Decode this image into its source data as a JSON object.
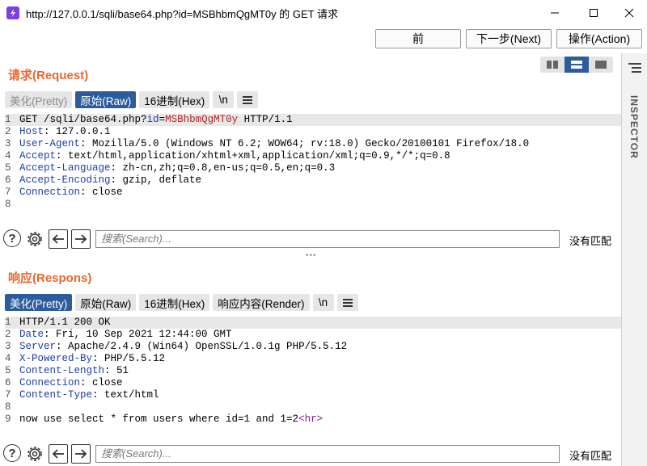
{
  "window": {
    "title": "http://127.0.0.1/sqli/base64.php?id=MSBhbmQgMT0y 的 GET 请求",
    "controls": {
      "minimize": "—",
      "maximize": "☐",
      "close": "✕"
    }
  },
  "nav": {
    "prev_label": "前",
    "next_label": "下一步(Next)",
    "action_label": "操作(Action)"
  },
  "inspector": {
    "label": "INSPECTOR"
  },
  "request": {
    "title": "请求(Request)",
    "tabs": [
      "美化(Pretty)",
      "原始(Raw)",
      "16进制(Hex)",
      "\\n"
    ],
    "lines": [
      {
        "n": "1",
        "method": "GET ",
        "path": "/sqli/base64.php?",
        "param": "id",
        "eq": "=",
        "val": "MSBhbmQgMT0y",
        "rest": " HTTP/1.1"
      },
      {
        "n": "2",
        "key": "Host",
        "value": ": 127.0.0.1"
      },
      {
        "n": "3",
        "key": "User-Agent",
        "value": ": Mozilla/5.0 (Windows NT 6.2; WOW64; rv:18.0) Gecko/20100101 Firefox/18.0"
      },
      {
        "n": "4",
        "key": "Accept",
        "value": ": text/html,application/xhtml+xml,application/xml;q=0.9,*/*;q=0.8"
      },
      {
        "n": "5",
        "key": "Accept-Language",
        "value": ": zh-cn,zh;q=0.8,en-us;q=0.5,en;q=0.3"
      },
      {
        "n": "6",
        "key": "Accept-Encoding",
        "value": ": gzip, deflate"
      },
      {
        "n": "7",
        "key": "Connection",
        "value": ": close"
      },
      {
        "n": "8",
        "key": "",
        "value": ""
      }
    ],
    "search_placeholder": "搜索(Search)...",
    "no_match": "没有匹配"
  },
  "response": {
    "title": "响应(Respons)",
    "tabs": [
      "美化(Pretty)",
      "原始(Raw)",
      "16进制(Hex)",
      "响应内容(Render)",
      "\\n"
    ],
    "status_line": "HTTP/1.1 200 OK",
    "lines": [
      {
        "n": "2",
        "key": "Date",
        "value": ": Fri, 10 Sep 2021 12:44:00 GMT"
      },
      {
        "n": "3",
        "key": "Server",
        "value": ": Apache/2.4.9 (Win64) OpenSSL/1.0.1g PHP/5.5.12"
      },
      {
        "n": "4",
        "key": "X-Powered-By",
        "value": ": PHP/5.5.12"
      },
      {
        "n": "5",
        "key": "Content-Length",
        "value": ": 51"
      },
      {
        "n": "6",
        "key": "Connection",
        "value": ": close"
      },
      {
        "n": "7",
        "key": "Content-Type",
        "value": ": text/html"
      },
      {
        "n": "8",
        "key": "",
        "value": ""
      }
    ],
    "body_line_n": "9",
    "body_text": "now use select * from users where id=1 and 1=2",
    "body_tag": "<hr>",
    "search_placeholder": "搜索(Search)...",
    "no_match": "没有匹配"
  }
}
